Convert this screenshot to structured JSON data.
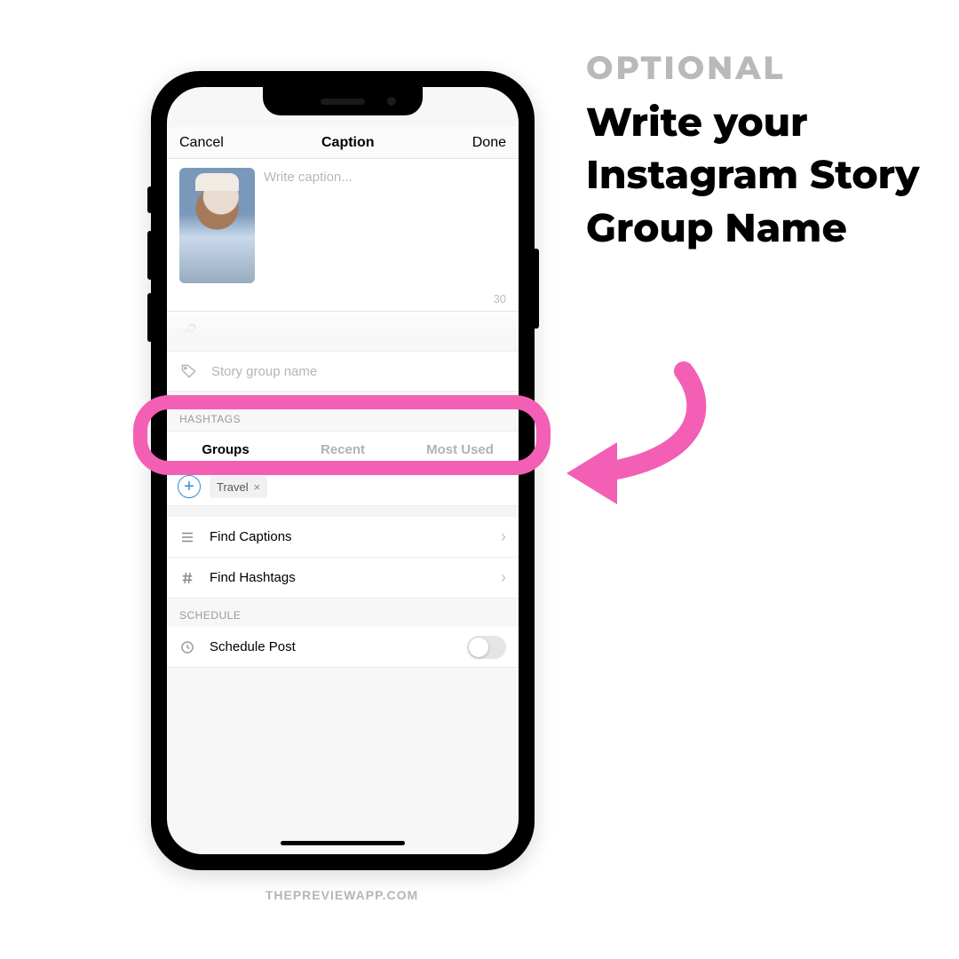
{
  "instruction": {
    "eyebrow": "OPTIONAL",
    "headline": "Write your Instagram Story Group Name"
  },
  "phone": {
    "nav": {
      "cancel": "Cancel",
      "title": "Caption",
      "done": "Done"
    },
    "caption": {
      "placeholder": "Write caption...",
      "counter": "30"
    },
    "story_group": {
      "placeholder": "Story group name"
    },
    "hashtags_label": "HASHTAGS",
    "tabs": {
      "groups": "Groups",
      "recent": "Recent",
      "most_used": "Most Used"
    },
    "chip": {
      "label": "Travel",
      "close": "×"
    },
    "find_captions": "Find Captions",
    "find_hashtags": "Find Hashtags",
    "schedule_label": "SCHEDULE",
    "schedule_post": "Schedule Post"
  },
  "watermark": "THEPREVIEWAPP.COM",
  "colors": {
    "pink": "#f35fb4"
  }
}
